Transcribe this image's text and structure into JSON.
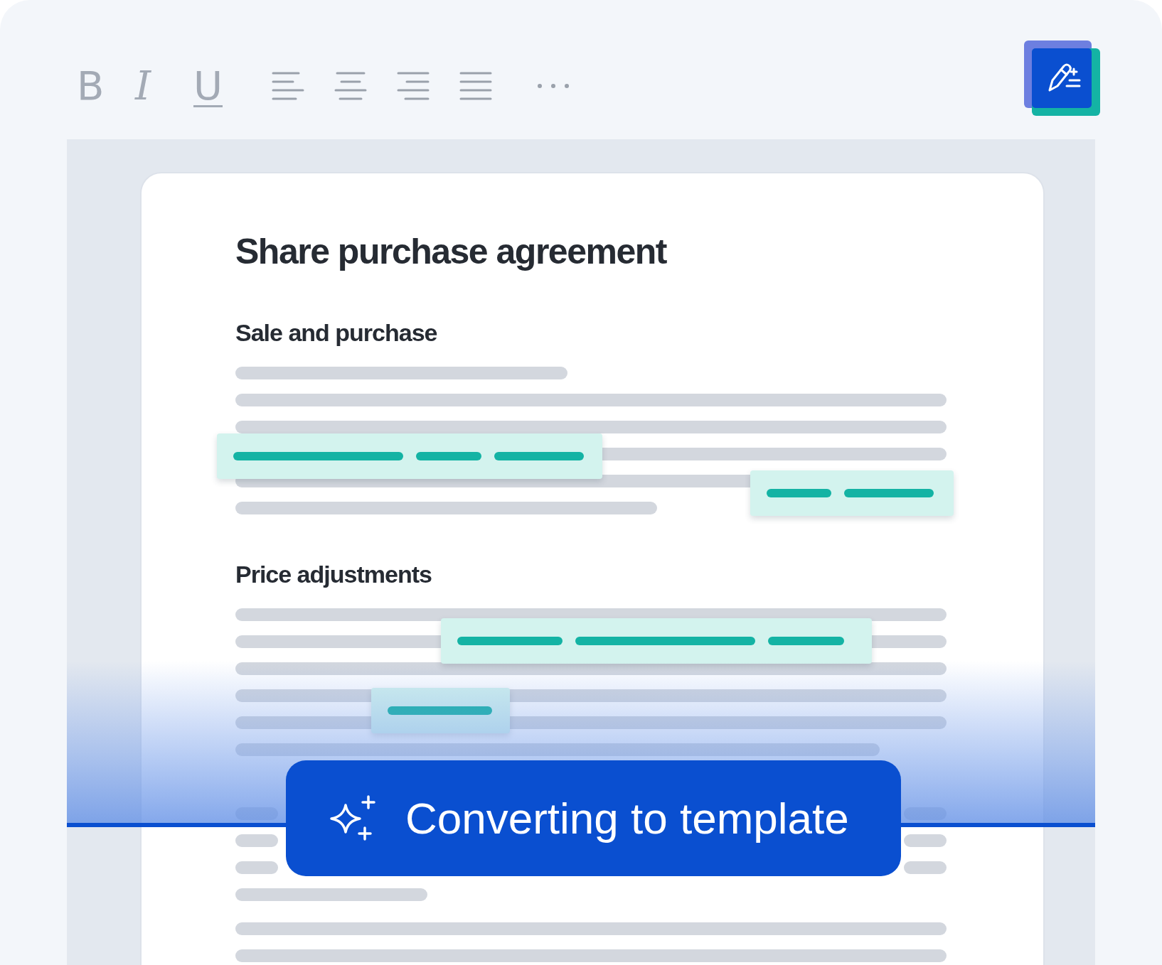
{
  "toolbar": {
    "format_buttons": [
      {
        "label": "B",
        "kind": "bold"
      },
      {
        "label": "I",
        "kind": "italic"
      },
      {
        "label": "U",
        "kind": "underline"
      }
    ]
  },
  "document": {
    "title": "Share purchase agreement",
    "sections": [
      {
        "heading": "Sale and purchase"
      },
      {
        "heading": "Price adjustments"
      }
    ]
  },
  "status_banner": {
    "text": "Converting to template"
  }
}
